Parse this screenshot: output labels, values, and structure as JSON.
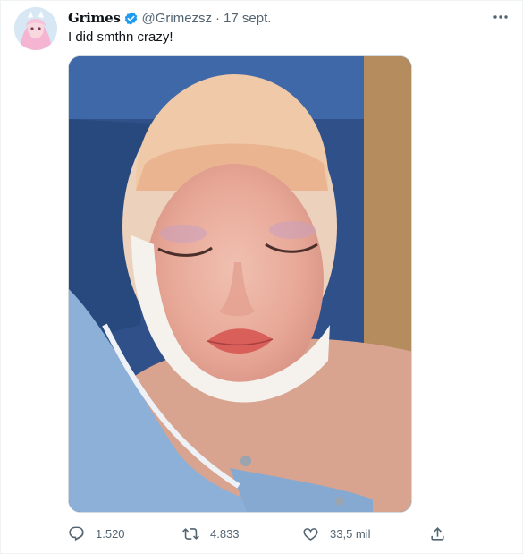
{
  "tweet": {
    "display_name": "Grimes",
    "handle": "@Grimezsz",
    "separator": "·",
    "date": "17 sept.",
    "text": "I did smthn crazy!",
    "verified": true
  },
  "actions": {
    "replies": "1.520",
    "retweets": "4.833",
    "likes": "33,5 mil"
  },
  "icons": {
    "more": "more-icon",
    "reply": "reply-icon",
    "retweet": "retweet-icon",
    "like": "heart-icon",
    "share": "share-icon",
    "verified": "verified-badge-icon"
  },
  "colors": {
    "verified_blue": "#1d9bf0",
    "secondary_text": "#536471",
    "primary_text": "#0f1419"
  }
}
